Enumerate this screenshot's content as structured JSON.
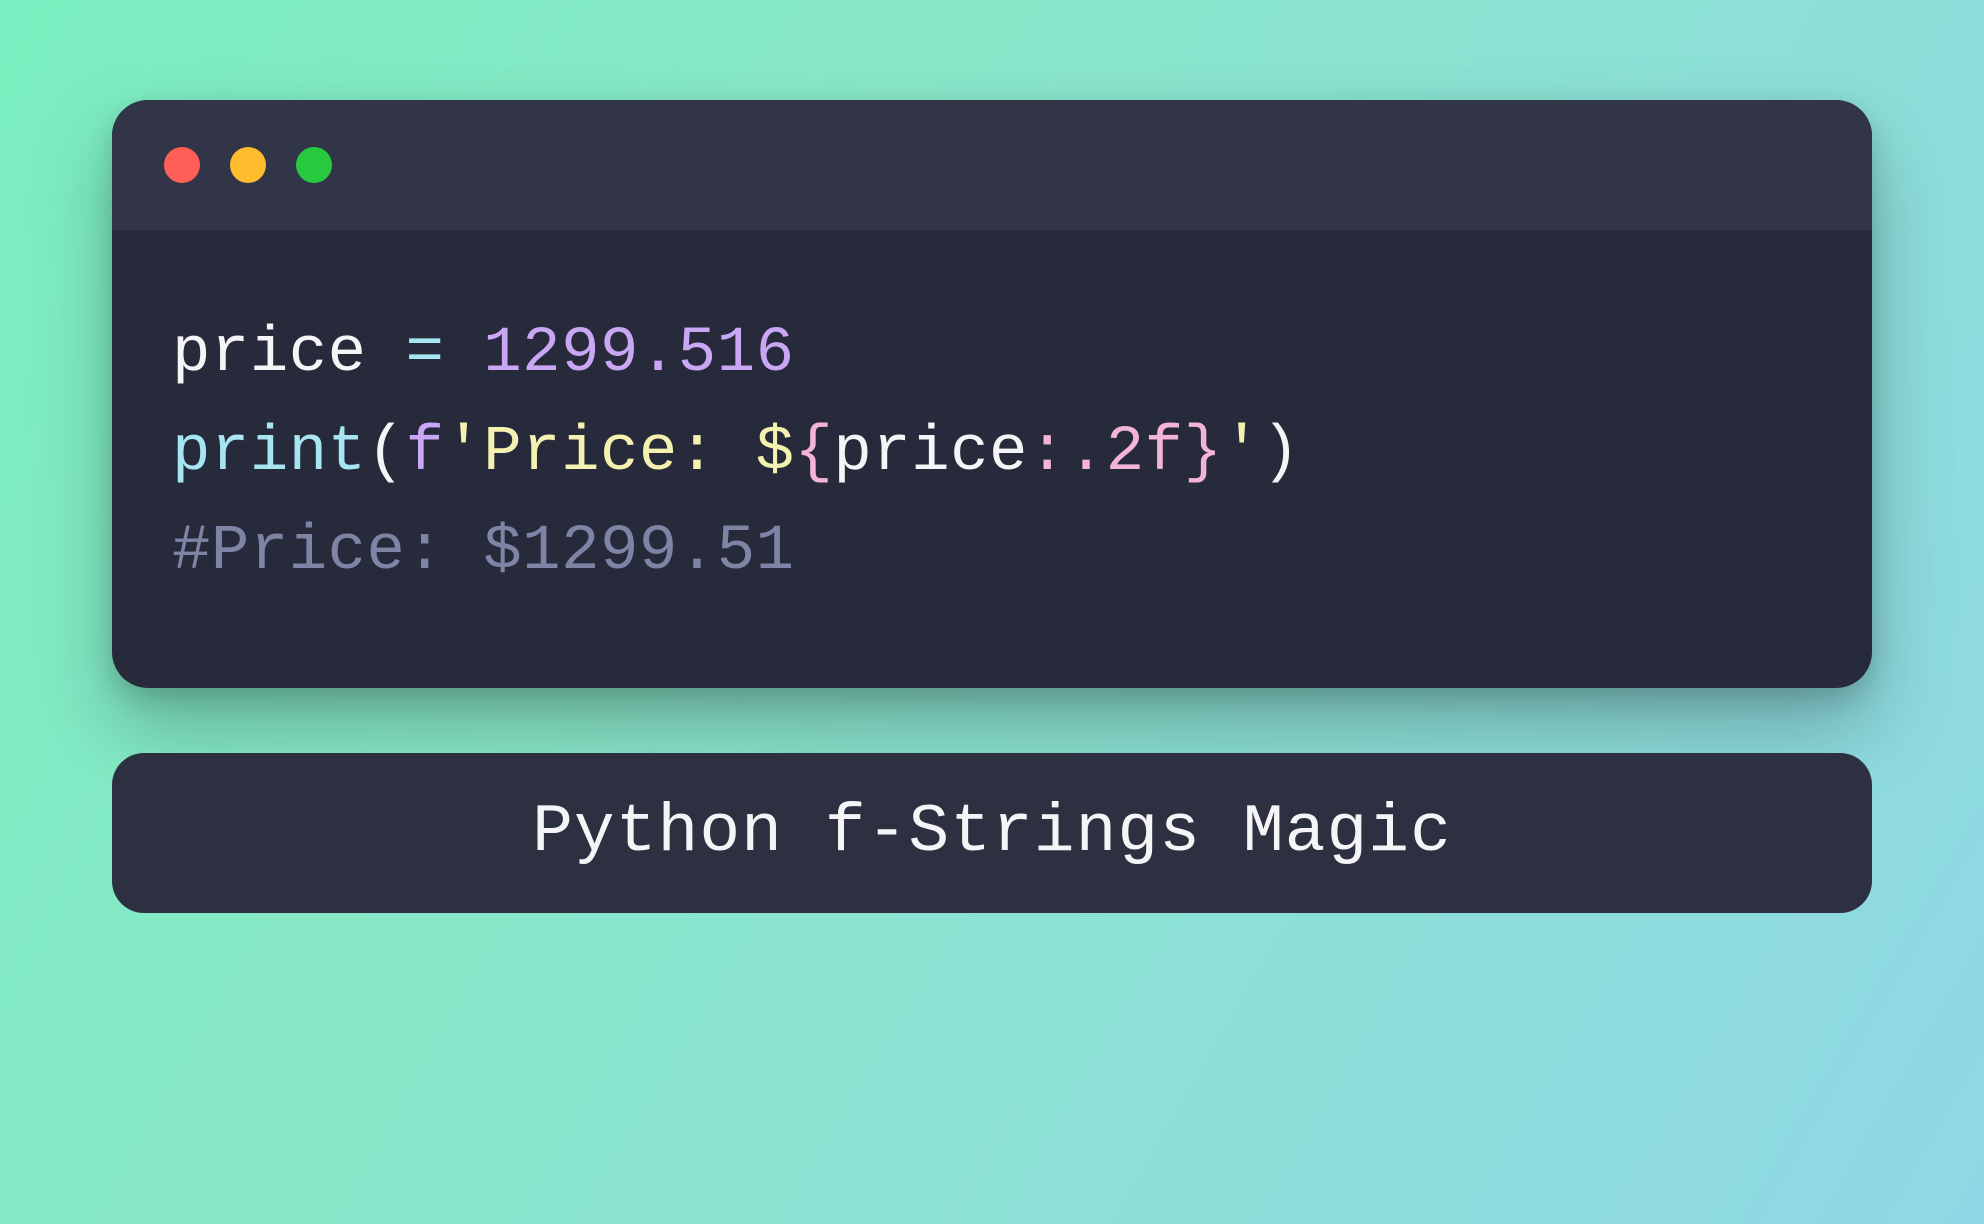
{
  "window": {
    "traffic_lights": [
      "red",
      "yellow",
      "green"
    ]
  },
  "code": {
    "line1": {
      "var": "price",
      "sp1": " ",
      "eq": "=",
      "sp2": " ",
      "num": "1299.516"
    },
    "line2": {
      "func": "print",
      "open_paren": "(",
      "f_prefix": "f",
      "quote_open": "'",
      "str1": "Price: $",
      "brace_open": "{",
      "expr": "price",
      "fmt": ":.2f",
      "brace_close": "}",
      "quote_close": "'",
      "close_paren": ")"
    },
    "line3": {
      "comment": "#Price: $1299.51"
    }
  },
  "caption": "Python f-Strings Magic"
}
